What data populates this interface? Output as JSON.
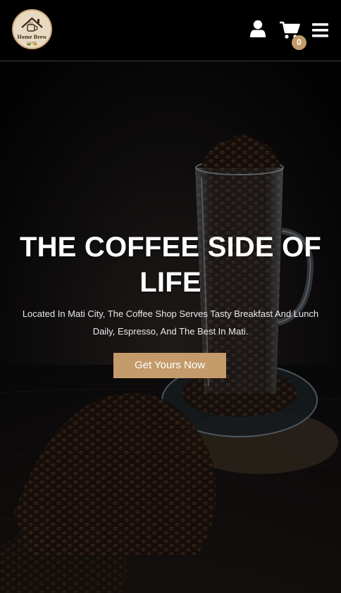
{
  "header": {
    "logo_text": "Home Brew",
    "logo_sub": "CAFE",
    "cart_count": "0",
    "icons": {
      "user": "user-icon",
      "cart": "cart-icon",
      "menu": "hamburger-menu-icon"
    }
  },
  "hero": {
    "title": "THE COFFEE SIDE OF LIFE",
    "description": "Located In Mati City, The Coffee Shop Serves Tasty Breakfast And Lunch Daily, Espresso, And The Best In Mati.",
    "cta_label": "Get Yours Now"
  },
  "colors": {
    "accent": "#c49b6a",
    "background": "#000000",
    "text": "#ffffff"
  }
}
